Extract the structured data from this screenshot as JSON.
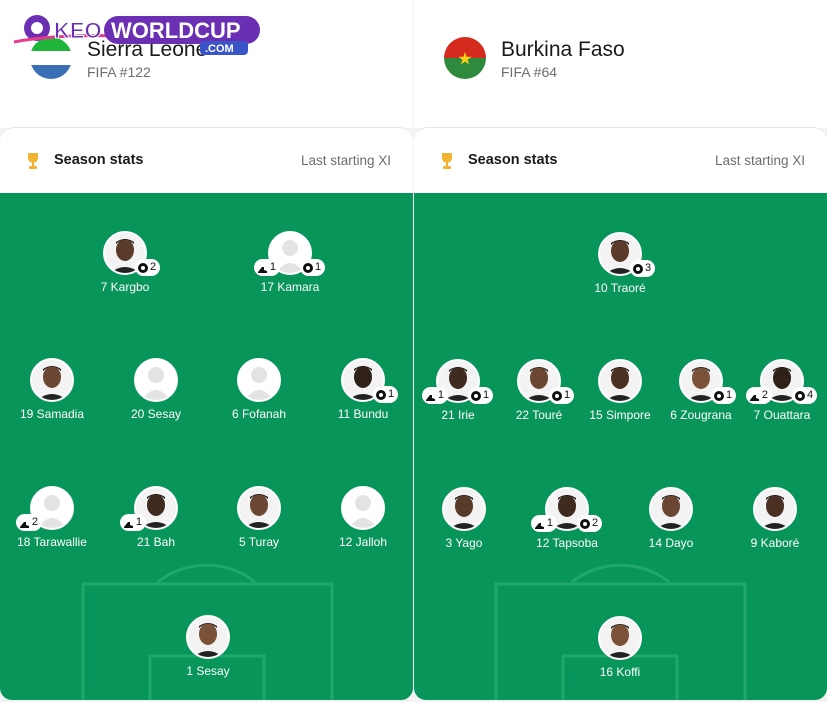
{
  "watermark": {
    "text_a": "KEO",
    "text_b": "WORLDCUP",
    "text_c": ".COM"
  },
  "left": {
    "team_name": "Sierra Leone",
    "team_rank": "FIFA #122",
    "stats_title": "Season stats",
    "stats_link": "Last starting XI",
    "players": [
      {
        "name": "7 Kargbo",
        "goals": "2",
        "assists": ""
      },
      {
        "name": "17 Kamara",
        "goals": "1",
        "assists": "1"
      },
      {
        "name": "19 Samadia",
        "goals": "",
        "assists": ""
      },
      {
        "name": "20 Sesay",
        "goals": "",
        "assists": ""
      },
      {
        "name": "6 Fofanah",
        "goals": "",
        "assists": ""
      },
      {
        "name": "11 Bundu",
        "goals": "1",
        "assists": ""
      },
      {
        "name": "18 Tarawallie",
        "goals": "",
        "assists": "2"
      },
      {
        "name": "21 Bah",
        "goals": "",
        "assists": "1"
      },
      {
        "name": "5 Turay",
        "goals": "",
        "assists": ""
      },
      {
        "name": "12 Jalloh",
        "goals": "",
        "assists": ""
      },
      {
        "name": "1 Sesay",
        "goals": "",
        "assists": ""
      }
    ]
  },
  "right": {
    "team_name": "Burkina Faso",
    "team_rank": "FIFA #64",
    "stats_title": "Season stats",
    "stats_link": "Last starting XI",
    "players": [
      {
        "name": "10 Traoré",
        "goals": "3",
        "assists": ""
      },
      {
        "name": "21 Irie",
        "goals": "1",
        "assists": "1"
      },
      {
        "name": "22 Touré",
        "goals": "1",
        "assists": ""
      },
      {
        "name": "15 Simpore",
        "goals": "",
        "assists": ""
      },
      {
        "name": "6 Zougrana",
        "goals": "1",
        "assists": ""
      },
      {
        "name": "7 Ouattara",
        "goals": "4",
        "assists": "2"
      },
      {
        "name": "3 Yago",
        "goals": "",
        "assists": ""
      },
      {
        "name": "12 Tapsoba",
        "goals": "2",
        "assists": "1"
      },
      {
        "name": "14 Dayo",
        "goals": "",
        "assists": ""
      },
      {
        "name": "9 Kaboré",
        "goals": "",
        "assists": ""
      },
      {
        "name": "16 Koffi",
        "goals": "",
        "assists": ""
      }
    ]
  },
  "colors": {
    "pitch": "#08955a",
    "trophy": "#f2b233"
  }
}
